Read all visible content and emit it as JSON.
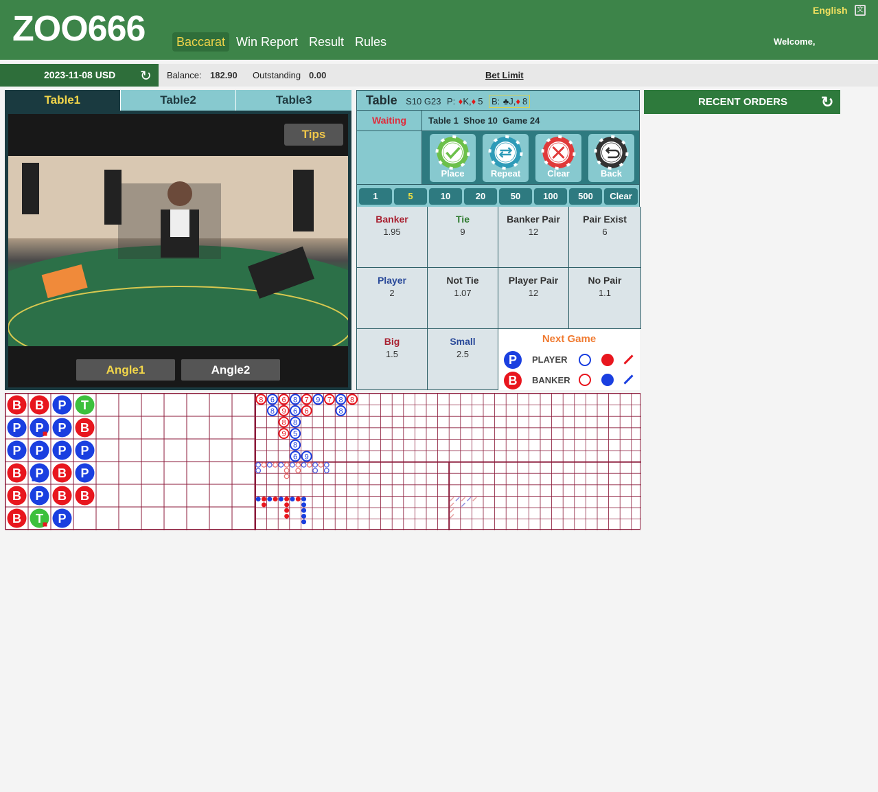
{
  "header": {
    "logo": "ZOO666",
    "nav": [
      "Baccarat",
      "Win Report",
      "Result",
      "Rules"
    ],
    "active_nav": "Baccarat",
    "language": "English",
    "welcome": "Welcome,"
  },
  "subbar": {
    "date_currency": "2023-11-08 USD",
    "balance_label": "Balance:",
    "balance": "182.90",
    "outstanding_label": "Outstanding",
    "outstanding": "0.00",
    "bet_limit": "Bet Limit"
  },
  "tables": {
    "tabs": [
      "Table1",
      "Table2",
      "Table3"
    ],
    "active": "Table1"
  },
  "video": {
    "tips": "Tips",
    "angles": [
      "Angle1",
      "Angle2"
    ],
    "active_angle": "Angle1"
  },
  "betpanel": {
    "title": "Table",
    "shoe_game": "S10 G23",
    "player_label": "P:",
    "player_cards": [
      "K",
      "5"
    ],
    "banker_label": "B:",
    "banker_cards": [
      "J",
      "8"
    ],
    "status": "Waiting",
    "table_info": "Table 1  Shoe 10  Game 24",
    "actions": [
      {
        "label": "Place",
        "color": "#6cc04a",
        "icon": "check"
      },
      {
        "label": "Repeat",
        "color": "#2e9bb8",
        "icon": "repeat"
      },
      {
        "label": "Clear",
        "color": "#e03a3a",
        "icon": "x"
      },
      {
        "label": "Back",
        "color": "#333333",
        "icon": "undo"
      }
    ],
    "chips": [
      "1",
      "5",
      "10",
      "20",
      "50",
      "100",
      "500",
      "Clear"
    ],
    "selected_chip": "5",
    "bets": [
      {
        "name": "Banker",
        "odds": "1.95",
        "color": "#a82030"
      },
      {
        "name": "Tie",
        "odds": "9",
        "color": "#2e7a2e"
      },
      {
        "name": "Banker Pair",
        "odds": "12",
        "color": "#333"
      },
      {
        "name": "Pair Exist",
        "odds": "6",
        "color": "#333"
      },
      {
        "name": "Player",
        "odds": "2",
        "color": "#2a4a9a"
      },
      {
        "name": "Not Tie",
        "odds": "1.07",
        "color": "#333"
      },
      {
        "name": "Player Pair",
        "odds": "12",
        "color": "#333"
      },
      {
        "name": "No Pair",
        "odds": "1.1",
        "color": "#333"
      },
      {
        "name": "Big",
        "odds": "1.5",
        "color": "#a82030"
      },
      {
        "name": "Small",
        "odds": "2.5",
        "color": "#2a4a9a"
      }
    ],
    "next_game": {
      "title": "Next Game",
      "player": "PLAYER",
      "banker": "BANKER",
      "p": "P",
      "b": "B"
    }
  },
  "recent_orders": {
    "title": "RECENT ORDERS"
  },
  "colors": {
    "banker": "#e8161e",
    "player": "#1a3fe0",
    "tie": "#3cc03c",
    "grid": "#8b1a3a"
  },
  "bead_plate": [
    [
      "B",
      "P",
      "P",
      "B",
      "B",
      "B"
    ],
    [
      "B",
      "P*r",
      "P",
      "P*b",
      "P",
      "T*r"
    ],
    [
      "P",
      "P",
      "P",
      "B",
      "B",
      "P"
    ],
    [
      "T",
      "B",
      "P",
      "P",
      "B"
    ]
  ],
  "big_road": [
    [
      0,
      0,
      "B",
      "8"
    ],
    [
      1,
      0,
      "P",
      "6"
    ],
    [
      1,
      1,
      "P",
      "8"
    ],
    [
      2,
      0,
      "B",
      "6"
    ],
    [
      2,
      1,
      "B",
      "9"
    ],
    [
      2,
      2,
      "B",
      "8"
    ],
    [
      2,
      3,
      "B",
      "9"
    ],
    [
      3,
      0,
      "P",
      "8"
    ],
    [
      3,
      1,
      "P",
      "6"
    ],
    [
      3,
      2,
      "P",
      "8"
    ],
    [
      3,
      3,
      "P",
      "5"
    ],
    [
      3,
      4,
      "P",
      "8"
    ],
    [
      3,
      5,
      "P",
      "6"
    ],
    [
      4,
      0,
      "B",
      "7"
    ],
    [
      4,
      1,
      "B",
      "6"
    ],
    [
      4,
      5,
      "P",
      "9"
    ],
    [
      5,
      0,
      "P",
      "9"
    ],
    [
      6,
      0,
      "B",
      "7"
    ],
    [
      7,
      0,
      "P",
      "8"
    ],
    [
      7,
      1,
      "P",
      "8"
    ],
    [
      8,
      0,
      "B",
      "8"
    ]
  ],
  "big_eye": [
    [
      0,
      0,
      "P"
    ],
    [
      1,
      0,
      "B"
    ],
    [
      2,
      0,
      "P"
    ],
    [
      3,
      0,
      "B"
    ],
    [
      4,
      0,
      "P"
    ],
    [
      5,
      0,
      "B"
    ],
    [
      6,
      0,
      "P"
    ],
    [
      7,
      0,
      "B"
    ],
    [
      8,
      0,
      "P"
    ],
    [
      9,
      0,
      "B"
    ],
    [
      10,
      0,
      "P"
    ],
    [
      11,
      0,
      "B"
    ],
    [
      12,
      0,
      "P"
    ],
    [
      0,
      1,
      "P"
    ],
    [
      5,
      1,
      "B"
    ],
    [
      7,
      1,
      "B"
    ],
    [
      10,
      1,
      "P"
    ],
    [
      12,
      1,
      "P"
    ],
    [
      5,
      2,
      "B"
    ]
  ],
  "small_road": [
    [
      0,
      0,
      "P"
    ],
    [
      1,
      0,
      "B"
    ],
    [
      2,
      0,
      "P"
    ],
    [
      3,
      0,
      "B"
    ],
    [
      4,
      0,
      "P"
    ],
    [
      5,
      0,
      "B"
    ],
    [
      6,
      0,
      "P"
    ],
    [
      7,
      0,
      "B"
    ],
    [
      8,
      0,
      "P"
    ],
    [
      1,
      1,
      "B"
    ],
    [
      5,
      1,
      "B"
    ],
    [
      8,
      1,
      "P"
    ],
    [
      5,
      2,
      "B"
    ],
    [
      8,
      2,
      "P"
    ],
    [
      5,
      3,
      "B"
    ],
    [
      8,
      3,
      "P"
    ],
    [
      8,
      4,
      "P"
    ]
  ],
  "cockroach": [
    [
      0,
      0,
      "B"
    ],
    [
      1,
      0,
      "P"
    ],
    [
      2,
      0,
      "B"
    ],
    [
      3,
      0,
      "P"
    ],
    [
      4,
      0,
      "B"
    ],
    [
      0,
      1,
      "B"
    ],
    [
      0,
      2,
      "B"
    ],
    [
      0,
      3,
      "B"
    ],
    [
      2,
      1,
      "P"
    ]
  ]
}
